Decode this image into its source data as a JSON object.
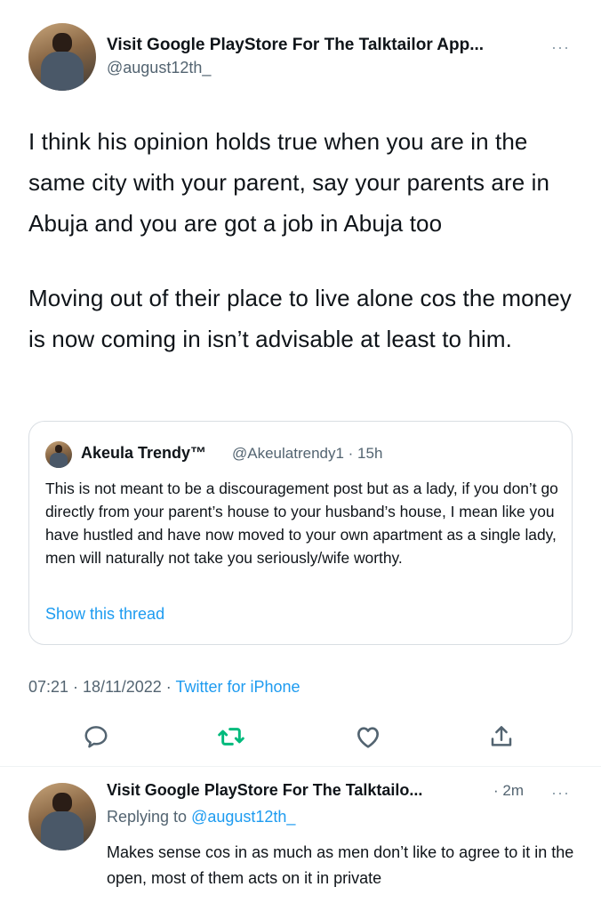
{
  "main_tweet": {
    "display_name": "Visit Google PlayStore For The Talktailor App...",
    "handle": "@august12th_",
    "paragraphs": [
      "I think his opinion holds true when you are in the same city with your parent, say your parents are in Abuja and you are got a job in Abuja too",
      "Moving out of their place to live alone cos the money is now coming in isn’t advisable at least to him."
    ],
    "more_icon": "···"
  },
  "quoted_tweet": {
    "display_name": "Akeula Trendy™",
    "handle_time": "@Akeulatrendy1 · 15h",
    "text": "This is not meant to be a discouragement post but as a lady, if you don’t go directly from your parent’s house to your husband’s house, I mean like you have hustled and have now moved to your own apartment as a single lady, men will naturally not take you seriously/wife worthy.",
    "thread_link": "Show this thread"
  },
  "meta": {
    "timestamp": "07:21 · 18/11/2022 · ",
    "source": "Twitter for iPhone"
  },
  "actions": {
    "icons": [
      "reply-icon",
      "retweet-icon",
      "like-icon",
      "share-icon"
    ],
    "retweet_color": "#00ba7c",
    "icon_color": "#536471"
  },
  "reply_tweet": {
    "display_name": "Visit Google PlayStore For The Talktailo...",
    "time": "· 2m",
    "replying_prefix": "Replying to ",
    "replying_mention": "@august12th_",
    "text": "Makes sense cos in as much as men don’t like to agree to it in the open, most of them acts on it in private",
    "more_icon": "···"
  },
  "colors": {
    "link": "#1d9bf0",
    "secondary": "#536471",
    "primary": "#0f1419"
  }
}
